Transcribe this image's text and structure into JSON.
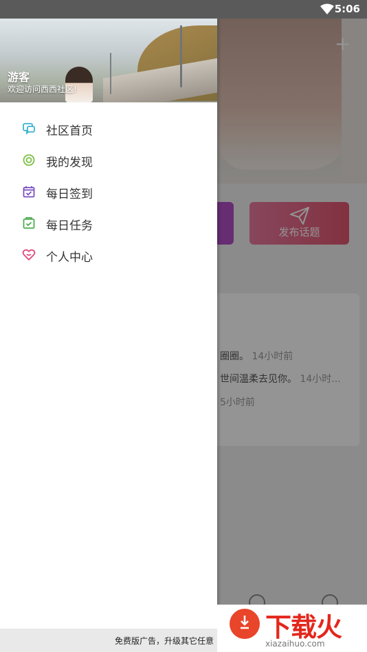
{
  "status_bar": {
    "time": "5:06"
  },
  "background": {
    "publish_button_label": "发布话题",
    "card_lines": [
      {
        "text": "圈圈。",
        "meta": "14小时前"
      },
      {
        "text": "世间温柔去见你。",
        "meta": "14小时..."
      },
      {
        "text": "",
        "meta": "5小时前"
      }
    ]
  },
  "drawer": {
    "header": {
      "user_name": "游客",
      "welcome_text": "欢迎访问西西社区!"
    },
    "menu": [
      {
        "label": "社区首页",
        "icon": "chat-bubble-icon",
        "color": "#3bb3cf"
      },
      {
        "label": "我的发现",
        "icon": "discover-icon",
        "color": "#7bc043"
      },
      {
        "label": "每日签到",
        "icon": "calendar-check-icon",
        "color": "#7b4fc0"
      },
      {
        "label": "每日任务",
        "icon": "task-icon",
        "color": "#4caf50"
      },
      {
        "label": "个人中心",
        "icon": "heart-icon",
        "color": "#e0457b"
      }
    ]
  },
  "ad_bar": {
    "text": "免费版广告，升级其它任意"
  },
  "watermark": {
    "brand": "下载火",
    "url": "xiazaihuo.com"
  }
}
